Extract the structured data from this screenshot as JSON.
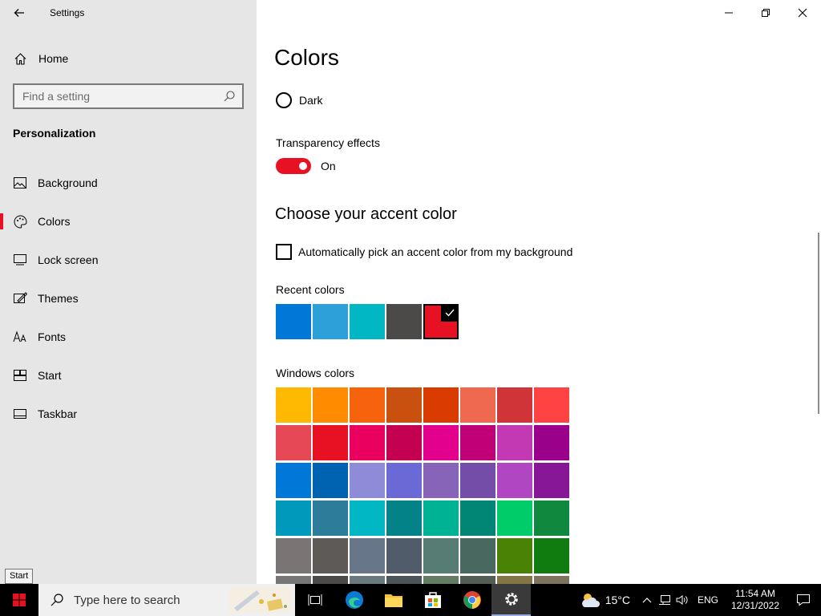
{
  "window": {
    "title": "Settings"
  },
  "sidebar": {
    "home_label": "Home",
    "search_placeholder": "Find a setting",
    "section": "Personalization",
    "items": [
      {
        "label": "Background",
        "icon": "picture-icon"
      },
      {
        "label": "Colors",
        "icon": "palette-icon",
        "active": true
      },
      {
        "label": "Lock screen",
        "icon": "lock-screen-icon"
      },
      {
        "label": "Themes",
        "icon": "themes-icon"
      },
      {
        "label": "Fonts",
        "icon": "fonts-icon"
      },
      {
        "label": "Start",
        "icon": "start-icon"
      },
      {
        "label": "Taskbar",
        "icon": "taskbar-icon"
      }
    ],
    "tooltip": "Start"
  },
  "main": {
    "title": "Colors",
    "mode_option": "Dark",
    "transparency_label": "Transparency effects",
    "transparency_state": "On",
    "accent_title": "Choose your accent color",
    "auto_pick_label": "Automatically pick an accent color from my background",
    "recent_label": "Recent colors",
    "recent_colors": [
      "#0078d7",
      "#2d9fd9",
      "#00b7c3",
      "#4c4a48",
      "#e81123"
    ],
    "selected_recent_index": 4,
    "windows_colors_label": "Windows colors",
    "windows_colors": [
      [
        "#ffb900",
        "#ff8c00",
        "#f7630c",
        "#ca5010",
        "#da3b01",
        "#ef6950",
        "#d13438",
        "#ff4343"
      ],
      [
        "#e74856",
        "#e81123",
        "#ea005e",
        "#c30052",
        "#e3008c",
        "#bf0077",
        "#c239b3",
        "#9a0089"
      ],
      [
        "#0078d7",
        "#0063b1",
        "#8e8cd8",
        "#6b69d6",
        "#8764b8",
        "#744da9",
        "#b146c2",
        "#881798"
      ],
      [
        "#0099bc",
        "#2d7d9a",
        "#00b7c3",
        "#038387",
        "#00b294",
        "#018574",
        "#00cc6a",
        "#10893e"
      ],
      [
        "#7a7574",
        "#5d5a58",
        "#68768a",
        "#515c6b",
        "#567c73",
        "#486860",
        "#498205",
        "#107c10"
      ],
      [
        "#767676",
        "#4c4a48",
        "#69797e",
        "#4a5459",
        "#647c64",
        "#525e54",
        "#847545",
        "#7e735f"
      ]
    ],
    "accent_color": "#e81123"
  },
  "taskbar": {
    "search_placeholder": "Type here to search",
    "weather_temp": "15°C",
    "language": "ENG",
    "time": "11:54 AM",
    "date": "12/31/2022"
  }
}
